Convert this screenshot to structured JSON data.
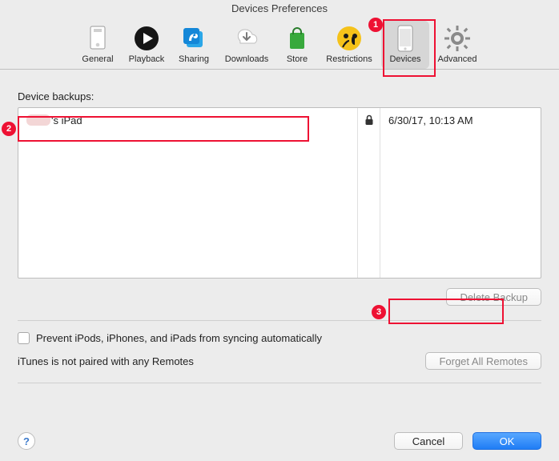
{
  "window": {
    "title": "Devices Preferences"
  },
  "toolbar": {
    "items": [
      {
        "label": "General"
      },
      {
        "label": "Playback"
      },
      {
        "label": "Sharing"
      },
      {
        "label": "Downloads"
      },
      {
        "label": "Store"
      },
      {
        "label": "Restrictions"
      },
      {
        "label": "Devices"
      },
      {
        "label": "Advanced"
      }
    ],
    "selected_index": 6
  },
  "section": {
    "backups_label": "Device backups:",
    "rows": [
      {
        "name_suffix": "'s iPad",
        "date": "6/30/17, 10:13 AM",
        "locked": true
      }
    ],
    "delete_button": "Delete Backup",
    "prevent_sync_label": "Prevent iPods, iPhones, and iPads from syncing automatically",
    "remotes_status": "iTunes is not paired with any Remotes",
    "forget_remotes_button": "Forget All Remotes"
  },
  "footer": {
    "help": "?",
    "cancel": "Cancel",
    "ok": "OK"
  },
  "annotations": {
    "n1": "1",
    "n2": "2",
    "n3": "3"
  }
}
